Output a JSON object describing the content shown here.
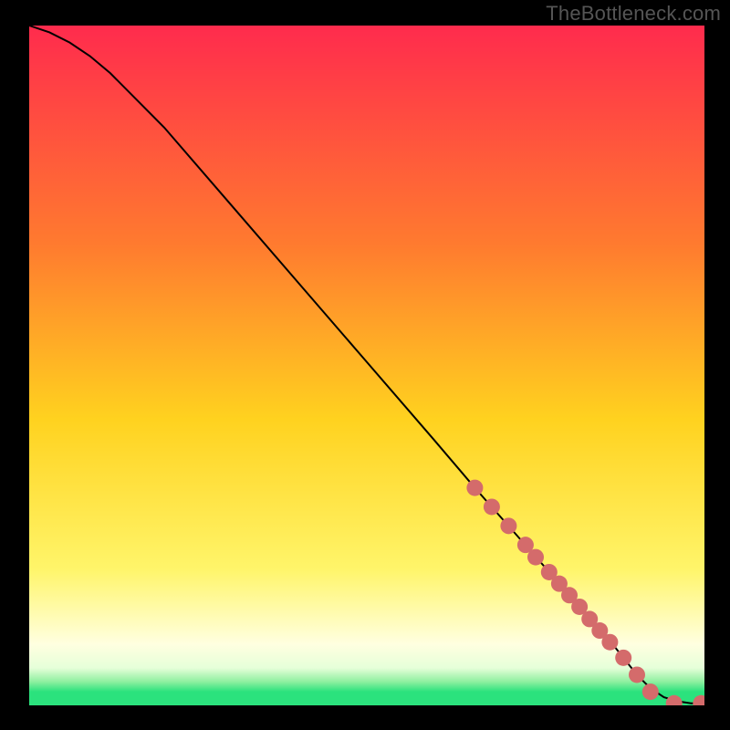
{
  "watermark": "TheBottleneck.com",
  "colors": {
    "page_bg": "#000000",
    "grad_top": "#ff2b4d",
    "grad_mid_upper": "#ff7a2f",
    "grad_mid": "#ffd21f",
    "grad_lower": "#fff56a",
    "grad_pale": "#ffffe0",
    "grad_pale2": "#e6ffd9",
    "grad_green1": "#8ff0a0",
    "grad_green2": "#2be27d",
    "line": "#000000",
    "marker": "#d46b6b"
  },
  "chart_data": {
    "type": "line",
    "title": "",
    "xlabel": "",
    "ylabel": "",
    "xlim": [
      0,
      100
    ],
    "ylim": [
      0,
      100
    ],
    "series": [
      {
        "name": "curve",
        "x": [
          0,
          3,
          6,
          9,
          12,
          20,
          30,
          40,
          50,
          60,
          66,
          70,
          74,
          78,
          82,
          86,
          88,
          90,
          92,
          94,
          96,
          98,
          100
        ],
        "values": [
          100,
          99,
          97.5,
          95.5,
          93,
          85,
          73.5,
          62,
          50.5,
          39,
          32,
          27.5,
          23,
          18.5,
          14,
          9.5,
          7,
          4.5,
          2.5,
          1.2,
          0.6,
          0.3,
          0.3
        ]
      }
    ],
    "markers": {
      "name": "dots",
      "x": [
        66,
        68.5,
        71,
        73.5,
        75,
        77,
        78.5,
        80,
        81.5,
        83,
        84.5,
        86,
        88,
        90,
        92,
        95.5,
        99.5
      ],
      "values": [
        32,
        29.2,
        26.4,
        23.6,
        21.8,
        19.6,
        17.9,
        16.2,
        14.5,
        12.7,
        11,
        9.3,
        7,
        4.5,
        2.0,
        0.3,
        0.3
      ]
    }
  }
}
